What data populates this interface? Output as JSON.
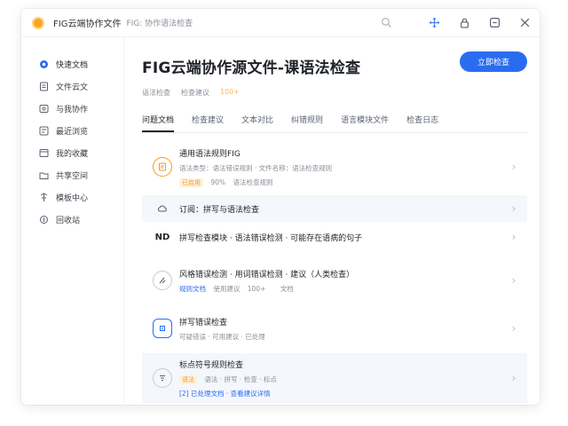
{
  "titlebar": {
    "app_title": "FIG云端协作文件",
    "subtitle": "FIG: 协作语法检查"
  },
  "sidebar": {
    "items": [
      {
        "label": "快速文档",
        "icon": "home-icon"
      },
      {
        "label": "文件云文",
        "icon": "doc-icon"
      },
      {
        "label": "与我协作",
        "icon": "share-icon"
      },
      {
        "label": "最近浏览",
        "icon": "clock-icon"
      },
      {
        "label": "我的收藏",
        "icon": "star-icon"
      },
      {
        "label": "共享空间",
        "icon": "folder-icon"
      },
      {
        "label": "模板中心",
        "icon": "template-icon"
      },
      {
        "label": "回收站",
        "icon": "trash-icon"
      }
    ]
  },
  "main": {
    "title": "FIG云端协作源文件-课语法检查",
    "action_button": "立即检查",
    "meta": [
      "语法检查",
      "检查建议",
      "100+"
    ],
    "tabs": [
      "问题文档",
      "检查建议",
      "文本对比",
      "纠错规则",
      "语言模块文件",
      "检查日志"
    ],
    "rows": [
      {
        "title": "通用语法规则FIG",
        "line1": "语法类型：语法错误规则 · 文件名称：语法检查规则",
        "tags": [
          "已启用",
          "90%",
          "语法检查规则"
        ],
        "highlight": false
      },
      {
        "title": "订阅：拼写与语法检查",
        "line1": "",
        "tags": [],
        "highlight": true
      },
      {
        "title": "拼写检查模块 · 语法错误检测 · 可能存在语病的句子",
        "line1": "",
        "tags": [],
        "highlight": false
      },
      {
        "title": "风格错误检测 · 用词错误检测 · 建议（人类检查）",
        "line1": "",
        "tags": [
          "规则文档",
          "使用建议",
          "100+",
          "文档"
        ],
        "highlight": false
      },
      {
        "title": "拼写错误检查",
        "line1": "可疑错误 · 可用建议 · 已处理",
        "tags": [],
        "highlight": false
      },
      {
        "title": "标点符号规则检查",
        "line1": "语法 · 拼写 · 检查 · 标点",
        "tags": [
          "语法",
          "[2] 已处理文档 · 查看建议详情"
        ],
        "highlight": true
      }
    ]
  },
  "colors": {
    "accent": "#2a6cf0",
    "orange": "#f59a23"
  }
}
